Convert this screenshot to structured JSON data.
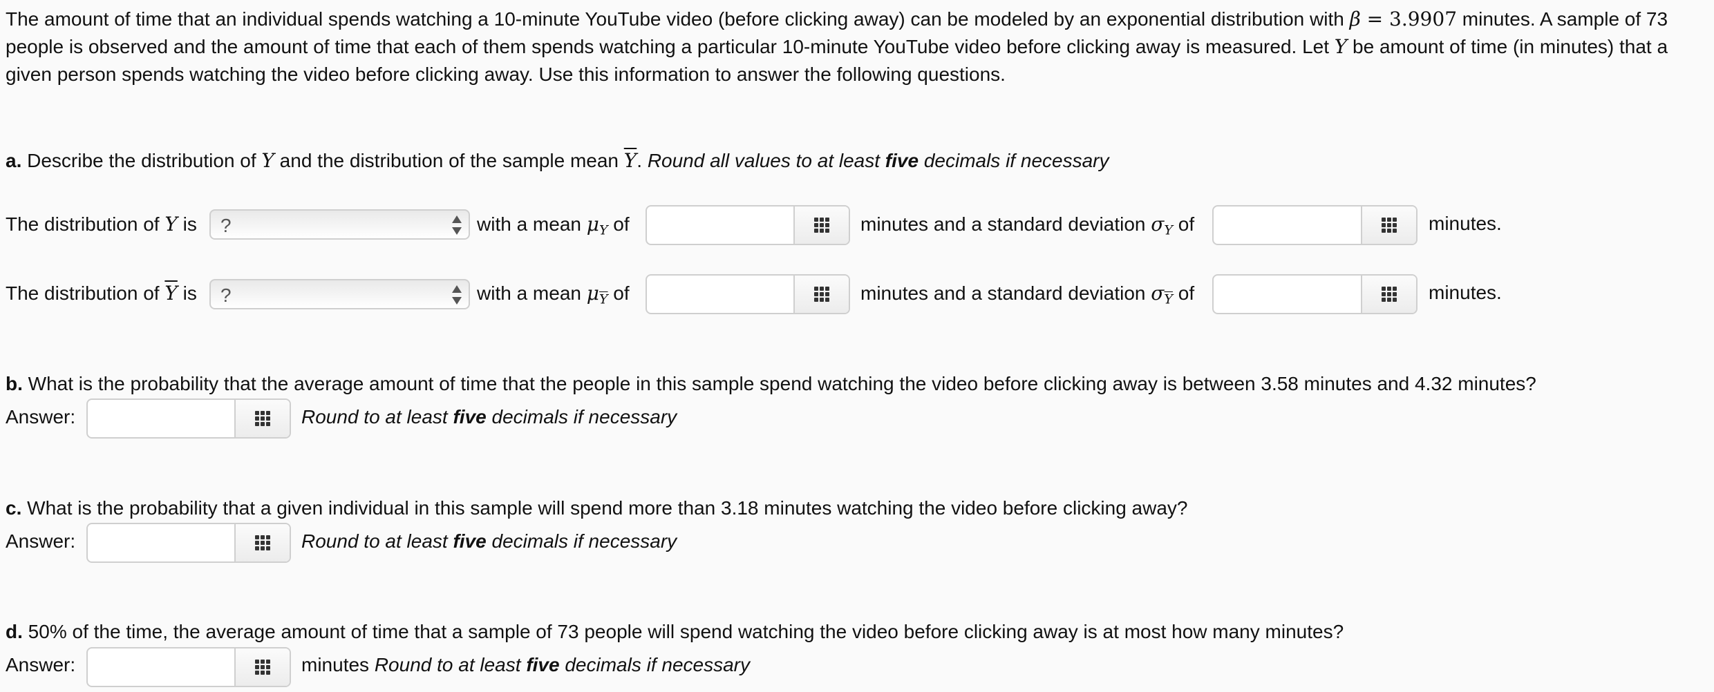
{
  "intro": {
    "part1": "The amount of time that an individual spends watching a 10-minute YouTube video (before clicking away) can be modeled by an exponential distribution with ",
    "beta_symbol": "β",
    "equals": " = ",
    "beta_value": "3.9907",
    "part2": " minutes. A sample of 73 people is observed and the amount of time that each of them spends watching a particular 10-minute YouTube video before clicking away is measured. Let ",
    "var": "Y",
    "part3": " be amount of time (in minutes) that a given person spends watching the video before clicking away. Use this information to answer the following questions."
  },
  "part_a": {
    "label": "a.",
    "text1": " Describe the distribution of ",
    "var": "Y",
    "text2": " and the distribution of the sample mean ",
    "var_bar": "Y",
    "text3": ". ",
    "hint": "Round all values to at least ",
    "hint_bold": "five",
    "hint_end": " decimals if necessary",
    "rows": [
      {
        "prefix": "The distribution of ",
        "var": "Y",
        "is": " is",
        "select_value": "?",
        "mean_label": "with a mean ",
        "mu": "μ",
        "mu_sub": "Y",
        "of": " of",
        "mean_value": "",
        "sd_label": "minutes and a standard deviation ",
        "sigma": "σ",
        "sigma_sub": "Y",
        "sd_value": "",
        "suffix": "minutes."
      },
      {
        "prefix": "The distribution of ",
        "var": "Y",
        "is": " is",
        "select_value": "?",
        "mean_label": "with a mean ",
        "mu": "μ",
        "mu_sub": "Y",
        "of": " of",
        "mean_value": "",
        "sd_label": "minutes and a standard deviation ",
        "sigma": "σ",
        "sigma_sub": "Y",
        "sd_value": "",
        "suffix": "minutes."
      }
    ]
  },
  "part_b": {
    "label": "b.",
    "question": " What is the probability that the average amount of time that the people in this sample spend watching the video before clicking away is between 3.58 minutes and 4.32 minutes?",
    "answer_label": "Answer:",
    "answer_value": "",
    "hint": "Round to at least ",
    "hint_bold": "five",
    "hint_end": " decimals if necessary"
  },
  "part_c": {
    "label": "c.",
    "question": " What is the probability that a given individual in this sample will spend more than 3.18 minutes watching the video before clicking away?",
    "answer_label": "Answer:",
    "answer_value": "",
    "hint": "Round to at least ",
    "hint_bold": "five",
    "hint_end": " decimals if necessary"
  },
  "part_d": {
    "label": "d.",
    "question": " 50% of the time, the average amount of time that a sample of 73 people will spend watching the video before clicking away is at most how many minutes?",
    "answer_label": "Answer:",
    "answer_value": "",
    "unit": "minutes ",
    "hint": "Round to at least ",
    "hint_bold": "five",
    "hint_end": " decimals if necessary"
  }
}
